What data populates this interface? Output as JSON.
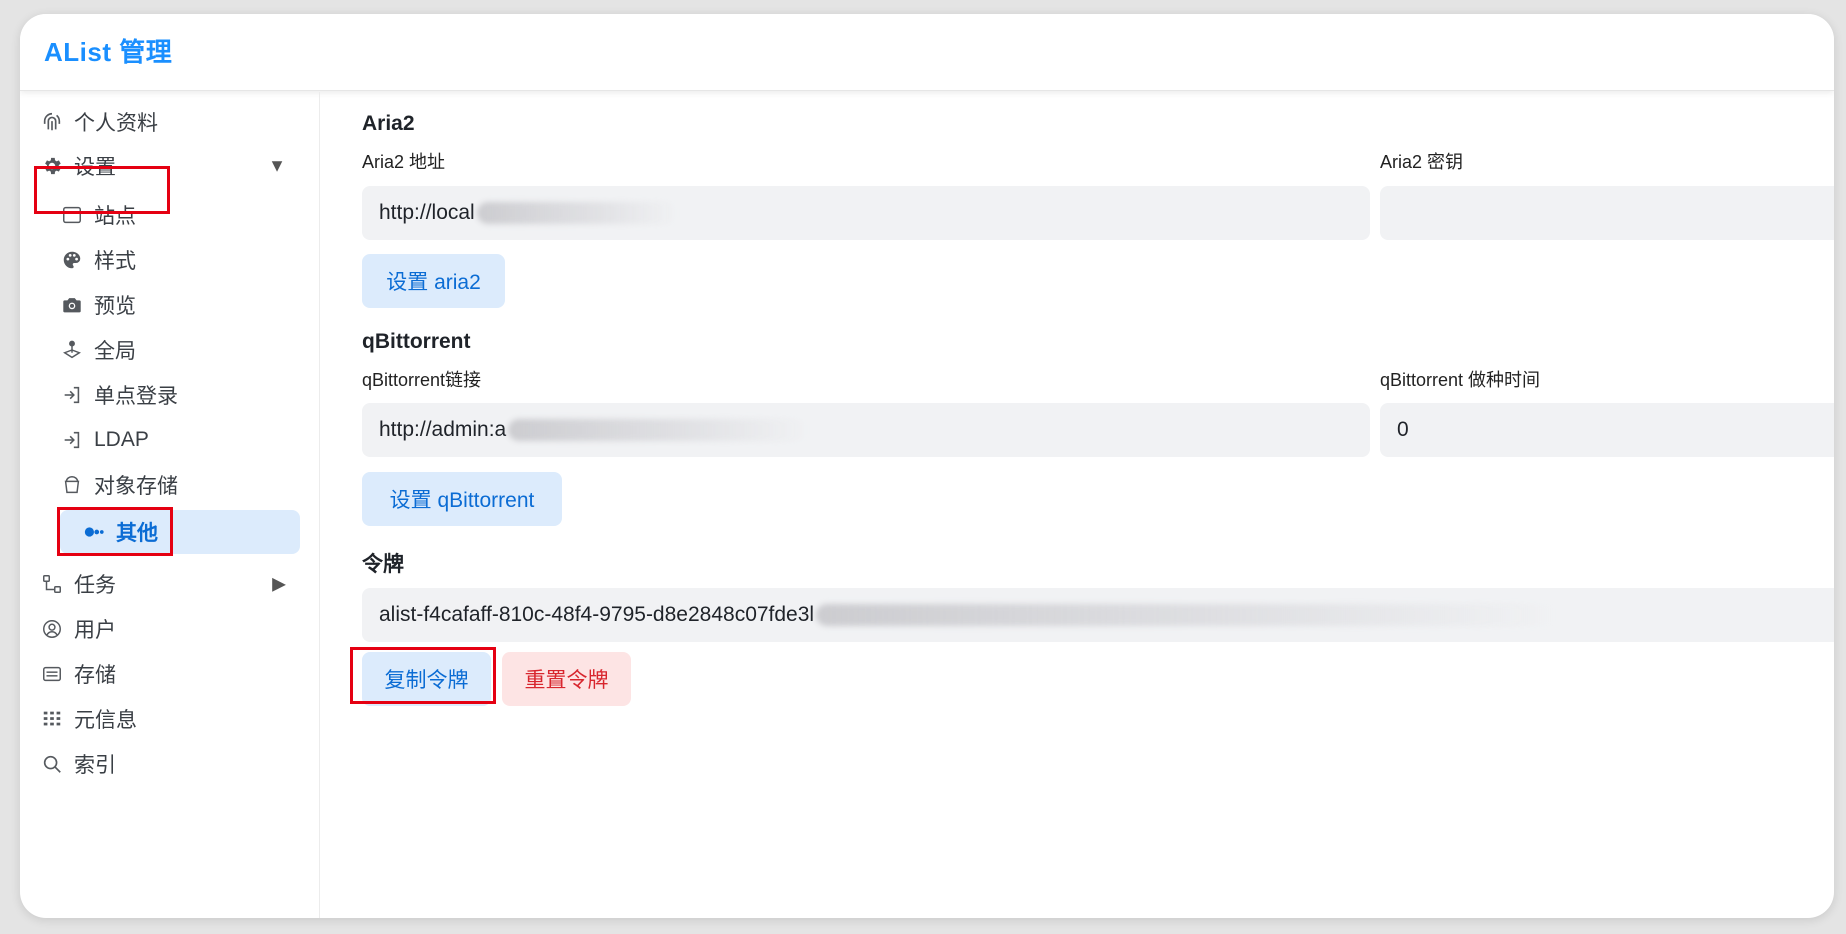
{
  "app": {
    "title": "AList 管理"
  },
  "sidebar": {
    "items": [
      {
        "label": "个人资料",
        "icon": "fingerprint-icon"
      },
      {
        "label": "设置",
        "icon": "gear-icon"
      },
      {
        "label": "站点",
        "icon": "browser-window-icon"
      },
      {
        "label": "样式",
        "icon": "palette-icon"
      },
      {
        "label": "预览",
        "icon": "camera-icon"
      },
      {
        "label": "全局",
        "icon": "joystick-icon"
      },
      {
        "label": "单点登录",
        "icon": "login-arrow-icon"
      },
      {
        "label": "LDAP",
        "icon": "login-arrow-icon"
      },
      {
        "label": "对象存储",
        "icon": "bucket-icon"
      },
      {
        "label": "其他",
        "icon": "toggle-dots-icon"
      },
      {
        "label": "任务",
        "icon": "tree-icon"
      },
      {
        "label": "用户",
        "icon": "user-circle-icon"
      },
      {
        "label": "存储",
        "icon": "storage-list-icon"
      },
      {
        "label": "元信息",
        "icon": "grid-icon"
      },
      {
        "label": "索引",
        "icon": "search-icon"
      }
    ]
  },
  "aria2": {
    "title": "Aria2",
    "address_label": "Aria2 地址",
    "address_value": "http://local",
    "secret_label": "Aria2 密钥",
    "secret_value": "",
    "button": "设置 aria2"
  },
  "qbit": {
    "title": "qBittorrent",
    "url_label": "qBittorrent链接",
    "url_value": "http://admin:a",
    "seed_label": "qBittorrent 做种时间",
    "seed_value": "0",
    "button": "设置 qBittorrent"
  },
  "token": {
    "title": "令牌",
    "value": "alist-f4cafaff-810c-48f4-9795-d8e2848c07fde3l",
    "copy_button": "复制令牌",
    "reset_button": "重置令牌"
  },
  "colors": {
    "accent": "#1a8fff",
    "active_bg": "#dcebfc",
    "danger": "#d8262e",
    "highlight": "#e50012"
  }
}
